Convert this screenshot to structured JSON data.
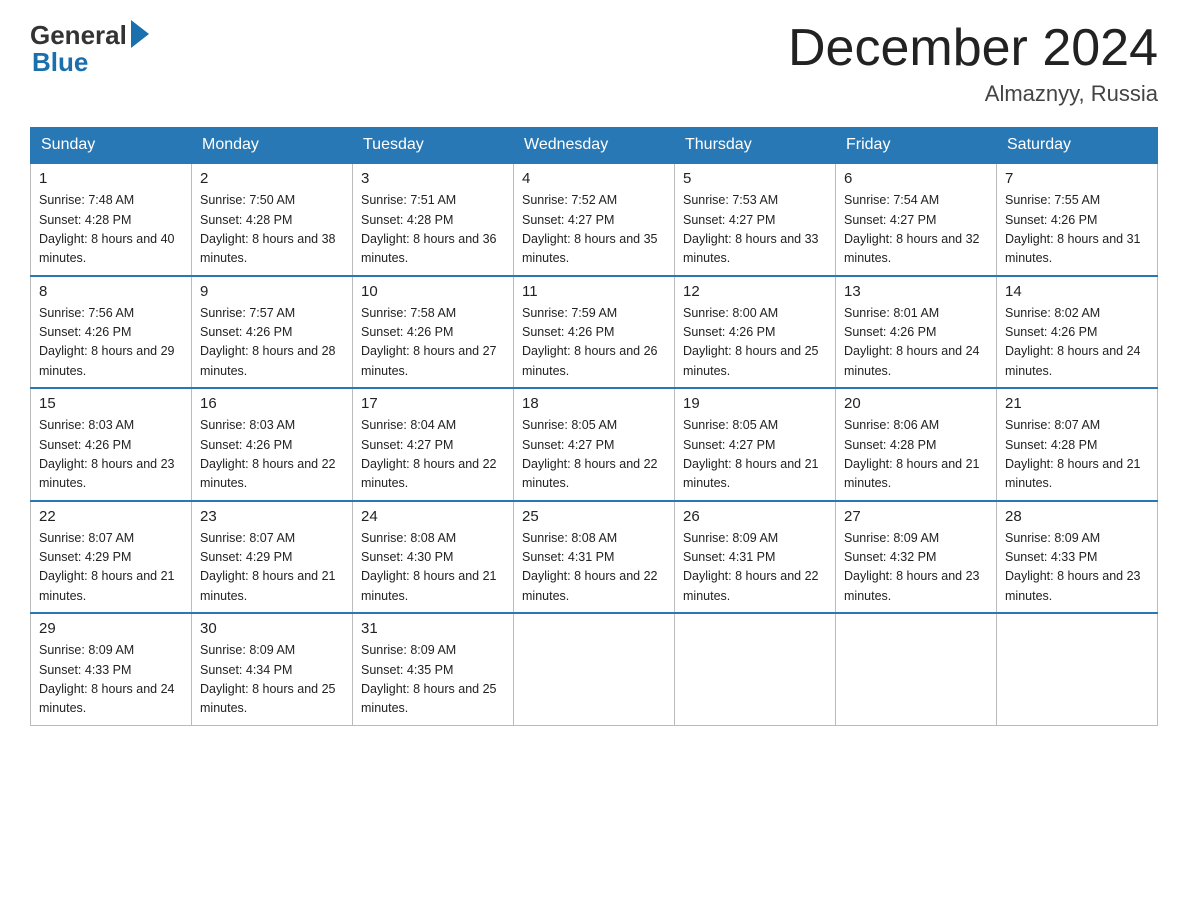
{
  "header": {
    "logo_general": "General",
    "logo_blue": "Blue",
    "month_title": "December 2024",
    "location": "Almaznyy, Russia"
  },
  "days_of_week": [
    "Sunday",
    "Monday",
    "Tuesday",
    "Wednesday",
    "Thursday",
    "Friday",
    "Saturday"
  ],
  "weeks": [
    [
      {
        "day": "1",
        "sunrise": "7:48 AM",
        "sunset": "4:28 PM",
        "daylight": "8 hours and 40 minutes."
      },
      {
        "day": "2",
        "sunrise": "7:50 AM",
        "sunset": "4:28 PM",
        "daylight": "8 hours and 38 minutes."
      },
      {
        "day": "3",
        "sunrise": "7:51 AM",
        "sunset": "4:28 PM",
        "daylight": "8 hours and 36 minutes."
      },
      {
        "day": "4",
        "sunrise": "7:52 AM",
        "sunset": "4:27 PM",
        "daylight": "8 hours and 35 minutes."
      },
      {
        "day": "5",
        "sunrise": "7:53 AM",
        "sunset": "4:27 PM",
        "daylight": "8 hours and 33 minutes."
      },
      {
        "day": "6",
        "sunrise": "7:54 AM",
        "sunset": "4:27 PM",
        "daylight": "8 hours and 32 minutes."
      },
      {
        "day": "7",
        "sunrise": "7:55 AM",
        "sunset": "4:26 PM",
        "daylight": "8 hours and 31 minutes."
      }
    ],
    [
      {
        "day": "8",
        "sunrise": "7:56 AM",
        "sunset": "4:26 PM",
        "daylight": "8 hours and 29 minutes."
      },
      {
        "day": "9",
        "sunrise": "7:57 AM",
        "sunset": "4:26 PM",
        "daylight": "8 hours and 28 minutes."
      },
      {
        "day": "10",
        "sunrise": "7:58 AM",
        "sunset": "4:26 PM",
        "daylight": "8 hours and 27 minutes."
      },
      {
        "day": "11",
        "sunrise": "7:59 AM",
        "sunset": "4:26 PM",
        "daylight": "8 hours and 26 minutes."
      },
      {
        "day": "12",
        "sunrise": "8:00 AM",
        "sunset": "4:26 PM",
        "daylight": "8 hours and 25 minutes."
      },
      {
        "day": "13",
        "sunrise": "8:01 AM",
        "sunset": "4:26 PM",
        "daylight": "8 hours and 24 minutes."
      },
      {
        "day": "14",
        "sunrise": "8:02 AM",
        "sunset": "4:26 PM",
        "daylight": "8 hours and 24 minutes."
      }
    ],
    [
      {
        "day": "15",
        "sunrise": "8:03 AM",
        "sunset": "4:26 PM",
        "daylight": "8 hours and 23 minutes."
      },
      {
        "day": "16",
        "sunrise": "8:03 AM",
        "sunset": "4:26 PM",
        "daylight": "8 hours and 22 minutes."
      },
      {
        "day": "17",
        "sunrise": "8:04 AM",
        "sunset": "4:27 PM",
        "daylight": "8 hours and 22 minutes."
      },
      {
        "day": "18",
        "sunrise": "8:05 AM",
        "sunset": "4:27 PM",
        "daylight": "8 hours and 22 minutes."
      },
      {
        "day": "19",
        "sunrise": "8:05 AM",
        "sunset": "4:27 PM",
        "daylight": "8 hours and 21 minutes."
      },
      {
        "day": "20",
        "sunrise": "8:06 AM",
        "sunset": "4:28 PM",
        "daylight": "8 hours and 21 minutes."
      },
      {
        "day": "21",
        "sunrise": "8:07 AM",
        "sunset": "4:28 PM",
        "daylight": "8 hours and 21 minutes."
      }
    ],
    [
      {
        "day": "22",
        "sunrise": "8:07 AM",
        "sunset": "4:29 PM",
        "daylight": "8 hours and 21 minutes."
      },
      {
        "day": "23",
        "sunrise": "8:07 AM",
        "sunset": "4:29 PM",
        "daylight": "8 hours and 21 minutes."
      },
      {
        "day": "24",
        "sunrise": "8:08 AM",
        "sunset": "4:30 PM",
        "daylight": "8 hours and 21 minutes."
      },
      {
        "day": "25",
        "sunrise": "8:08 AM",
        "sunset": "4:31 PM",
        "daylight": "8 hours and 22 minutes."
      },
      {
        "day": "26",
        "sunrise": "8:09 AM",
        "sunset": "4:31 PM",
        "daylight": "8 hours and 22 minutes."
      },
      {
        "day": "27",
        "sunrise": "8:09 AM",
        "sunset": "4:32 PM",
        "daylight": "8 hours and 23 minutes."
      },
      {
        "day": "28",
        "sunrise": "8:09 AM",
        "sunset": "4:33 PM",
        "daylight": "8 hours and 23 minutes."
      }
    ],
    [
      {
        "day": "29",
        "sunrise": "8:09 AM",
        "sunset": "4:33 PM",
        "daylight": "8 hours and 24 minutes."
      },
      {
        "day": "30",
        "sunrise": "8:09 AM",
        "sunset": "4:34 PM",
        "daylight": "8 hours and 25 minutes."
      },
      {
        "day": "31",
        "sunrise": "8:09 AM",
        "sunset": "4:35 PM",
        "daylight": "8 hours and 25 minutes."
      },
      null,
      null,
      null,
      null
    ]
  ]
}
